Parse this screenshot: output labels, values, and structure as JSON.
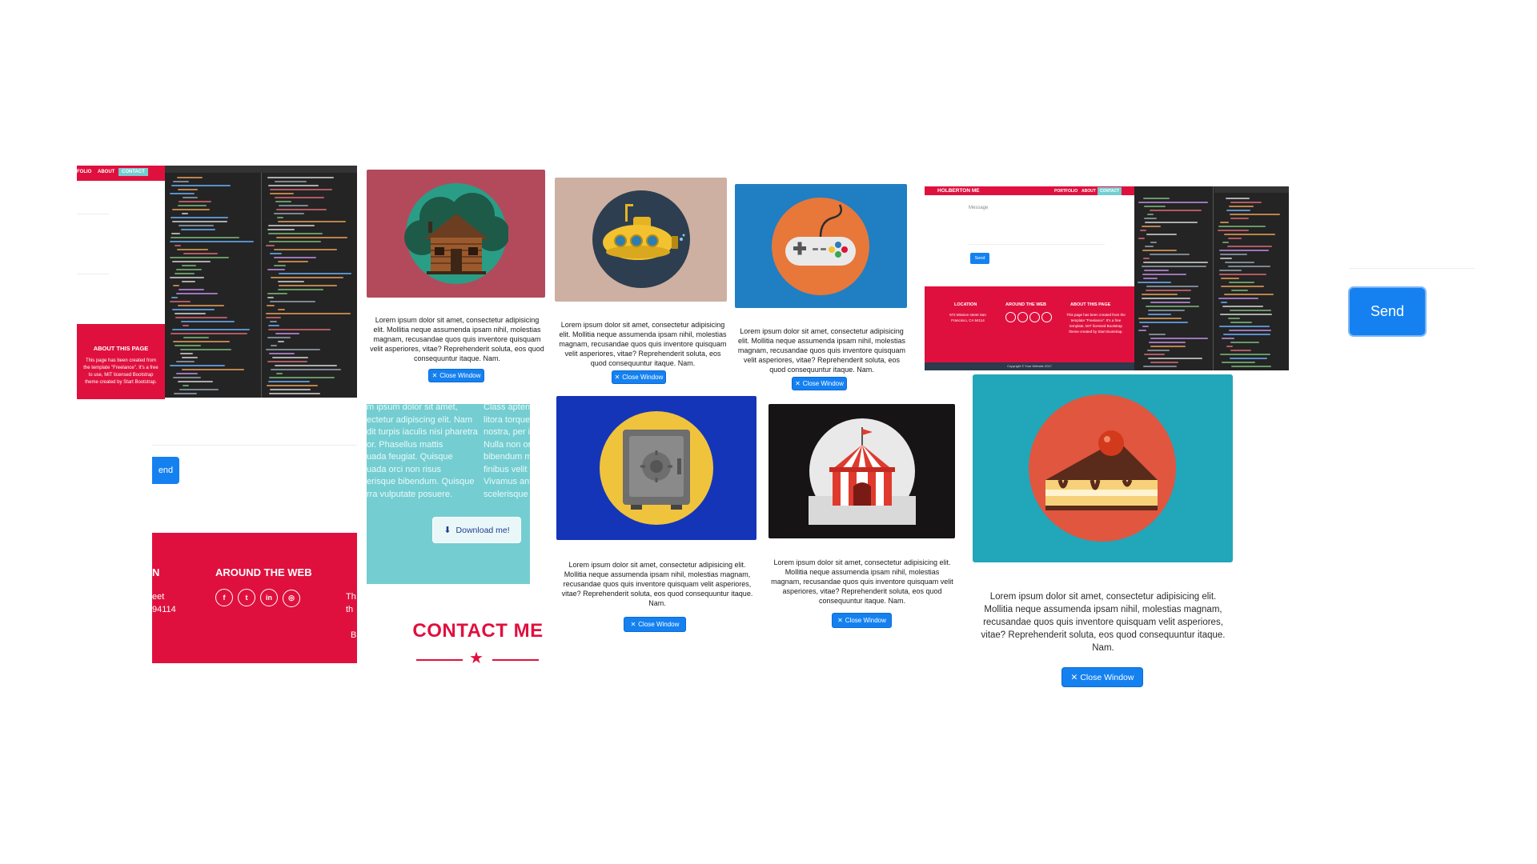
{
  "lorem_text": "Lorem ipsum dolor sit amet, consectetur adipisicing elit. Mollitia neque assumenda ipsam nihil, molestias magnam, recusandae quos quis inventore quisquam velit asperiores, vitae? Reprehenderit soluta, eos quod consequuntur itaque. Nam.",
  "close_window_label": "Close Window",
  "left_shot": {
    "nav": [
      "FOLIO",
      "ABOUT",
      "CONTACT"
    ],
    "about_title": "ABOUT THIS PAGE",
    "about_text": "This page has been created from the template \"Freelance\". It's a free to use, MIT licensed Bootstrap theme created by Start Bootstrap.",
    "send_partial": "end"
  },
  "footer_partial": {
    "heading_cut": "N",
    "around_title": "AROUND THE WEB",
    "address_line1": "eet",
    "address_line2": "94114",
    "right_cut1": "Th",
    "right_cut2": "th",
    "right_cut3": "B",
    "social_icons": [
      "facebook-icon",
      "twitter-icon",
      "linkedin-icon",
      "dribbble-icon"
    ]
  },
  "teal_section": {
    "col1": [
      "m ipsum dolor sit amet,",
      "ectetur adipiscing elit. Nam",
      "dit turpis iaculis nisi pharetra",
      "or. Phasellus mattis",
      "uada feugiat. Quisque",
      "uada orci non risus",
      "erisque bibendum. Quisque",
      "rra vulputate posuere."
    ],
    "col2": [
      "Class aptent taciti so",
      "litora torquent per c",
      "nostra, per inceptos",
      "Nulla non ornare pu",
      "bibendum maximus",
      "finibus velit tristique",
      "Vivamus ante mi, m",
      "scelerisque nec, feu"
    ],
    "download_label": "Download me!"
  },
  "contact_title": "CONTACT ME",
  "right_shot": {
    "brand": "HOLBERTON ME",
    "nav": [
      "PORTFOLIO",
      "ABOUT",
      "CONTACT"
    ],
    "message_label": "Message",
    "send_label": "Send",
    "footer_cols": [
      "LOCATION",
      "AROUND THE WEB",
      "ABOUT THIS PAGE"
    ],
    "location_text": "972 Mission street San Francisco, CA 94114",
    "about_text": "This page has been created from the template \"Freelance\". It's a free template, MIT licensed Bootstrap theme created by Start Bootstrap.",
    "copyright": "Copyright © Your Website 2017"
  },
  "send_button_label": "Send",
  "tiles": [
    {
      "icon": "cabin-icon",
      "bg": "#b34a5b"
    },
    {
      "icon": "submarine-icon",
      "bg": "#cdb0a2"
    },
    {
      "icon": "gamepad-icon",
      "bg": "#1f7fc2"
    },
    {
      "icon": "safe-icon",
      "bg": "#1535b8"
    },
    {
      "icon": "circus-tent-icon",
      "bg": "#161414"
    },
    {
      "icon": "cake-icon",
      "bg": "#22a6b9"
    }
  ],
  "colors": {
    "accent": "#e0103e",
    "button": "#1581f0",
    "teal": "#74cdd1"
  }
}
